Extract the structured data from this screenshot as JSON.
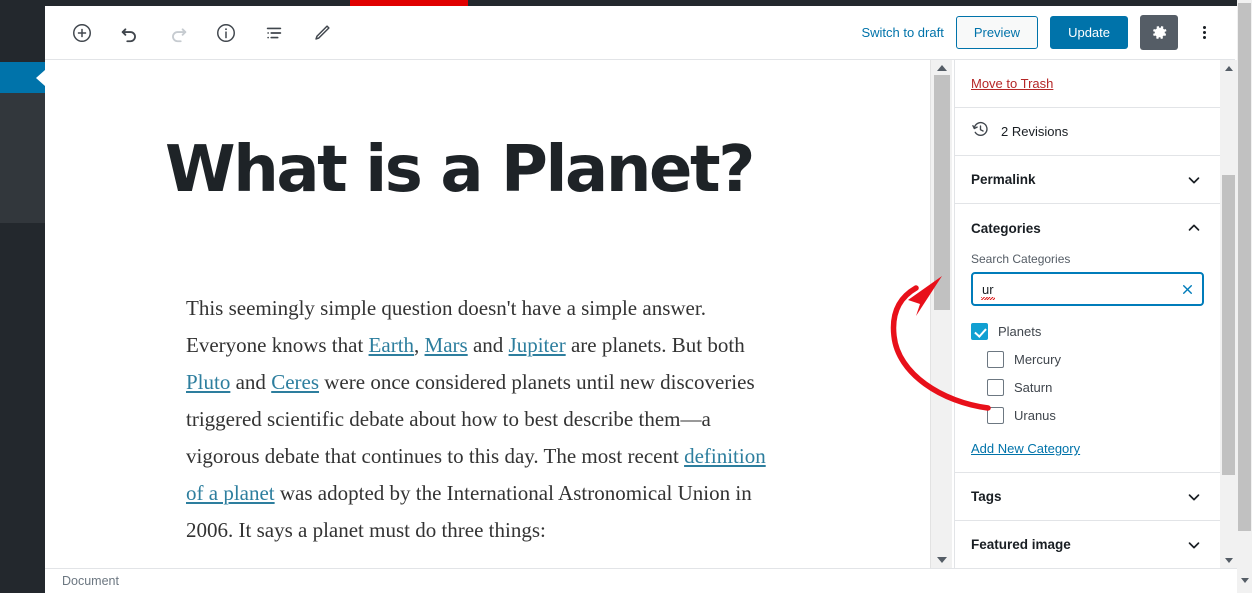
{
  "editor": {
    "toolbar": {
      "icons": [
        {
          "name": "add-block-icon",
          "label": "Add block"
        },
        {
          "name": "undo-icon",
          "label": "Undo"
        },
        {
          "name": "redo-icon",
          "label": "Redo"
        },
        {
          "name": "info-icon",
          "label": "Content structure"
        },
        {
          "name": "list-view-icon",
          "label": "Block navigation"
        },
        {
          "name": "edit-pencil-icon",
          "label": "Edit"
        }
      ],
      "switch_to_draft": "Switch to draft",
      "preview": "Preview",
      "update": "Update",
      "settings_gear": "gear-icon",
      "more_menu": "kebab-icon"
    },
    "post": {
      "title": "What is a Planet?",
      "paragraph_segments": [
        {
          "type": "text",
          "text": "This seemingly simple question doesn't have a simple answer. Everyone knows that "
        },
        {
          "type": "link",
          "text": "Earth"
        },
        {
          "type": "text",
          "text": ", "
        },
        {
          "type": "link",
          "text": "Mars"
        },
        {
          "type": "text",
          "text": " and "
        },
        {
          "type": "link",
          "text": "Jupiter"
        },
        {
          "type": "text",
          "text": " are planets. But both "
        },
        {
          "type": "link",
          "text": "Pluto"
        },
        {
          "type": "text",
          "text": " and "
        },
        {
          "type": "link",
          "text": "Ceres"
        },
        {
          "type": "text",
          "text": " were once considered planets until new discoveries triggered scientific debate about how to best describe them—a vigorous debate that continues to this day. The most recent "
        },
        {
          "type": "link",
          "text": "definition of a planet"
        },
        {
          "type": "text",
          "text": " was adopted by the International Astronomical Union in 2006. It says a planet must do three things:"
        }
      ]
    },
    "status_bar": {
      "breadcrumb": "Document"
    }
  },
  "settings_panel": {
    "move_to_trash": "Move to Trash",
    "revisions": "2 Revisions",
    "revisions_icon": "clock-revisions-icon",
    "sections": [
      {
        "title": "Permalink",
        "state": "collapsed",
        "chevron": "chevron-down-icon"
      },
      {
        "title": "Categories",
        "state": "expanded",
        "chevron": "chevron-up-icon"
      },
      {
        "title": "Tags",
        "state": "collapsed",
        "chevron": "chevron-down-icon"
      },
      {
        "title": "Featured image",
        "state": "collapsed",
        "chevron": "chevron-down-icon"
      }
    ],
    "categories": {
      "search_label": "Search Categories",
      "search_value": "ur",
      "search_placeholder": "Search Categories",
      "clear_icon": "clear-x-icon",
      "items": [
        {
          "label": "Planets",
          "checked": true,
          "child": false
        },
        {
          "label": "Mercury",
          "checked": false,
          "child": true
        },
        {
          "label": "Saturn",
          "checked": false,
          "child": true
        },
        {
          "label": "Uranus",
          "checked": false,
          "child": true
        }
      ],
      "add_new": "Add New Category"
    }
  },
  "annotation": {
    "type": "curved-arrow",
    "color": "#e8101a",
    "points_to": "search-categories-input"
  },
  "colors": {
    "accent_blue": "#0073aa",
    "checkbox_blue": "#11a0d2",
    "focus_blue": "#007cba",
    "trash_red": "#b52727",
    "annotation_red": "#e8101a",
    "sidebar_dark": "#23282d",
    "link_teal": "#2d7e9e"
  }
}
